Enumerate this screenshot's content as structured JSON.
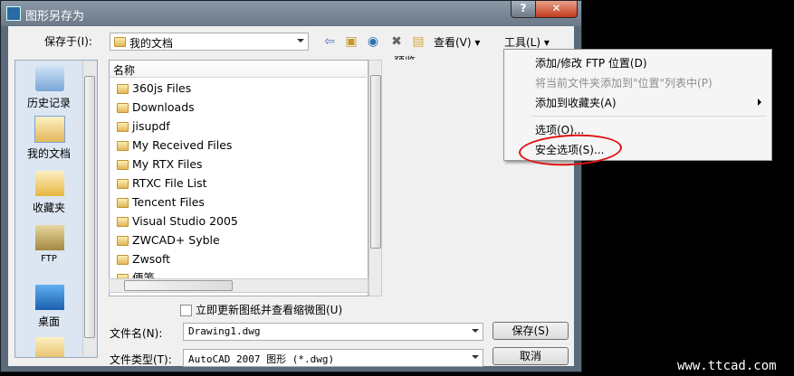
{
  "window": {
    "title": "图形另存为",
    "help": "?",
    "close": "✕"
  },
  "toolbar": {
    "save_in_label": "保存于(I):",
    "save_in_value": "我的文档",
    "views_label": "查看(V)",
    "tools_label": "工具(L)"
  },
  "places": [
    {
      "label": "历史记录"
    },
    {
      "label": "我的文档"
    },
    {
      "label": "收藏夹"
    },
    {
      "label": "FTP"
    },
    {
      "label": "桌面"
    }
  ],
  "filelist": {
    "column_name": "名称",
    "items": [
      "360js Files",
      "Downloads",
      "jisupdf",
      "My Received Files",
      "My RTX Files",
      "RTXC File List",
      "Tencent Files",
      "Visual Studio 2005",
      "ZWCAD+ Syble",
      "Zwsoft",
      "便笺"
    ]
  },
  "preview_label": "预览",
  "update_thumbnail_label": "立即更新图纸并查看缩微图(U)",
  "filename_label": "文件名(N):",
  "filename_value": "Drawing1.dwg",
  "filetype_label": "文件类型(T):",
  "filetype_value": "AutoCAD 2007 图形 (*.dwg)",
  "save_button": "保存(S)",
  "cancel_button": "取消",
  "tools_menu": {
    "add_ftp": "添加/修改 FTP 位置(D)",
    "add_to_places": "将当前文件夹添加到\"位置\"列表中(P)",
    "add_to_favorites": "添加到收藏夹(A)",
    "options": "选项(O)...",
    "security": "安全选项(S)..."
  },
  "watermark": "www.ttcad.com"
}
